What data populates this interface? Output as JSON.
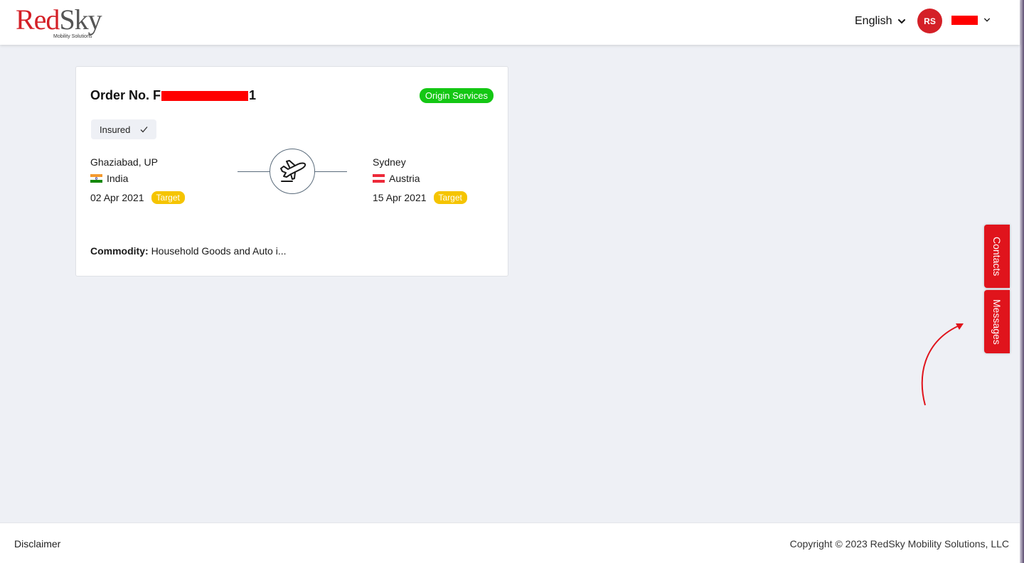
{
  "header": {
    "logo": {
      "brand_red": "Red",
      "brand_gray": "Sky",
      "tagline": "Mobility Solutions"
    },
    "language": "English",
    "avatar_initials": "RS"
  },
  "order_card": {
    "title_prefix": "Order No. F",
    "title_suffix": "1",
    "service_badge": "Origin Services",
    "insured_label": "Insured",
    "origin": {
      "city": "Ghaziabad, UP",
      "country": "India",
      "date": "02 Apr 2021",
      "date_badge": "Target"
    },
    "destination": {
      "city": "Sydney",
      "country": "Austria",
      "date": "15 Apr 2021",
      "date_badge": "Target"
    },
    "commodity_label": "Commodity:",
    "commodity_value": "Household Goods and Auto i..."
  },
  "side_tabs": {
    "contacts": "Contacts",
    "messages": "Messages"
  },
  "footer": {
    "disclaimer": "Disclaimer",
    "copyright": "Copyright © 2023 RedSky Mobility Solutions, LLC"
  },
  "colors": {
    "brand_red": "#d42027",
    "tab_red": "#e0141c",
    "service_green": "#14c714",
    "target_yellow": "#f5c400",
    "redaction": "#ff0000",
    "page_bg": "#eef0f5"
  }
}
